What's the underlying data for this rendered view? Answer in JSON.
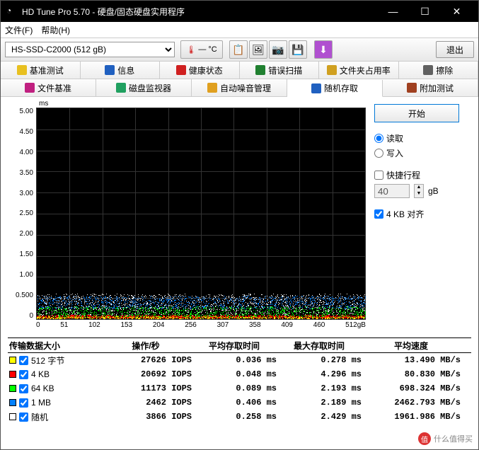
{
  "window": {
    "title": "HD Tune Pro 5.70 - 硬盘/固态硬盘实用程序"
  },
  "menubar": {
    "file": "文件(F)",
    "help": "帮助(H)"
  },
  "toolbar": {
    "drive": "HS-SSD-C2000 (512 gB)",
    "temp": "— °C",
    "exit": "退出"
  },
  "tabs_row1": [
    {
      "label": "基准测试",
      "icon": "lightbulb-icon",
      "color": "#e8c020"
    },
    {
      "label": "信息",
      "icon": "info-icon",
      "color": "#2060c0"
    },
    {
      "label": "健康状态",
      "icon": "health-icon",
      "color": "#d02020"
    },
    {
      "label": "错误扫描",
      "icon": "scan-icon",
      "color": "#208030"
    },
    {
      "label": "文件夹占用率",
      "icon": "folder-icon",
      "color": "#d0a020"
    },
    {
      "label": "擦除",
      "icon": "erase-icon",
      "color": "#606060"
    }
  ],
  "tabs_row2": [
    {
      "label": "文件基准",
      "icon": "file-icon",
      "color": "#c02080"
    },
    {
      "label": "磁盘监视器",
      "icon": "monitor-icon",
      "color": "#20a060"
    },
    {
      "label": "自动噪音管理",
      "icon": "sound-icon",
      "color": "#e0a020"
    },
    {
      "label": "随机存取",
      "icon": "random-icon",
      "color": "#2060c0",
      "active": true
    },
    {
      "label": "附加测试",
      "icon": "extra-icon",
      "color": "#a04020"
    }
  ],
  "side": {
    "start": "开始",
    "read": "读取",
    "write": "写入",
    "shortstroke": "快捷行程",
    "size_value": "40",
    "size_unit": "gB",
    "align": "4 KB 对齐"
  },
  "chart_data": {
    "type": "scatter",
    "title": "",
    "xlabel": "",
    "ylabel": "ms",
    "xunit": "gB",
    "xlim": [
      0,
      512
    ],
    "ylim": [
      0,
      5.0
    ],
    "xticks": [
      0,
      51,
      102,
      153,
      204,
      256,
      307,
      358,
      409,
      460,
      "512gB"
    ],
    "yticks": [
      "5.00",
      "4.50",
      "4.00",
      "3.50",
      "3.00",
      "2.50",
      "2.00",
      "1.50",
      "1.00",
      "0.500",
      "0"
    ],
    "series": [
      {
        "name": "512 字节",
        "color": "#ffff00",
        "approx_band_ms": [
          0.02,
          0.07
        ]
      },
      {
        "name": "4 KB",
        "color": "#ff0000",
        "approx_band_ms": [
          0.03,
          0.1
        ]
      },
      {
        "name": "64 KB",
        "color": "#00ff00",
        "approx_band_ms": [
          0.05,
          0.3
        ]
      },
      {
        "name": "1 MB",
        "color": "#0080ff",
        "approx_band_ms": [
          0.25,
          0.55
        ]
      },
      {
        "name": "随机",
        "color": "#ffffff",
        "approx_band_ms": [
          0.1,
          0.6
        ]
      }
    ]
  },
  "results": {
    "headers": [
      "传输数据大小",
      "操作/秒",
      "平均存取时间",
      "最大存取时间",
      "平均速度"
    ],
    "rows": [
      {
        "swatch": "#ffff00",
        "label": "512 字节",
        "iops": "27626 IOPS",
        "avg": "0.036 ms",
        "max": "0.278 ms",
        "speed": "13.490 MB/s"
      },
      {
        "swatch": "#ff0000",
        "label": "4 KB",
        "iops": "20692 IOPS",
        "avg": "0.048 ms",
        "max": "4.296 ms",
        "speed": "80.830 MB/s"
      },
      {
        "swatch": "#00ff00",
        "label": "64 KB",
        "iops": "11173 IOPS",
        "avg": "0.089 ms",
        "max": "2.193 ms",
        "speed": "698.324 MB/s"
      },
      {
        "swatch": "#0080ff",
        "label": "1 MB",
        "iops": "2462 IOPS",
        "avg": "0.406 ms",
        "max": "2.189 ms",
        "speed": "2462.793 MB/s"
      },
      {
        "swatch": "#ffffff",
        "label": "随机",
        "iops": "3866 IOPS",
        "avg": "0.258 ms",
        "max": "2.429 ms",
        "speed": "1961.986 MB/s"
      }
    ]
  },
  "watermark": "什么值得买"
}
